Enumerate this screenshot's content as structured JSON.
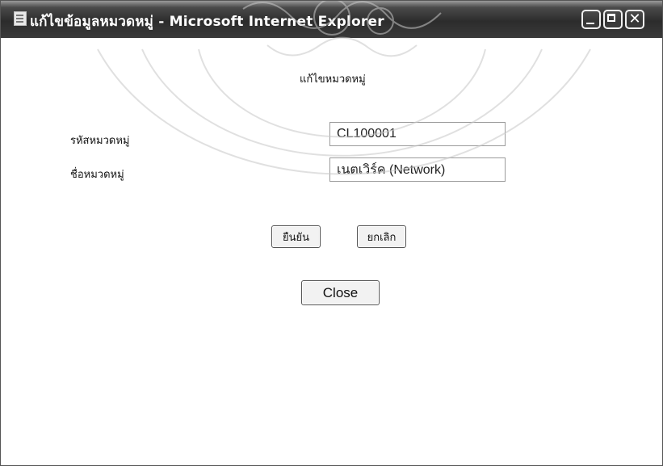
{
  "window": {
    "title_page": "แก้ไขข้อมูลหมวดหมู่",
    "title_separator": " - ",
    "title_app": "Microsoft Internet Explorer",
    "controls": {
      "minimize": "minimize-icon",
      "maximize": "maximize-icon",
      "close": "close-icon",
      "close_glyph": "✕"
    }
  },
  "form": {
    "heading": "แก้ไขหมวดหมู่",
    "fields": {
      "category_code_label": "รหัสหมวดหมู่",
      "category_code_value": "CL100001",
      "category_name_label": "ชื่อหมวดหมู่",
      "category_name_value": "เนตเวิร์ค (Network)"
    },
    "buttons": {
      "confirm": "ยืนยัน",
      "cancel": "ยกเลิก",
      "close": "Close"
    }
  },
  "colors": {
    "titlebar": "#2c2c2c",
    "title_text": "#ffffff",
    "background": "#ffffff",
    "field_border": "#9a9a9a",
    "watermark": "#c8c8c8"
  }
}
